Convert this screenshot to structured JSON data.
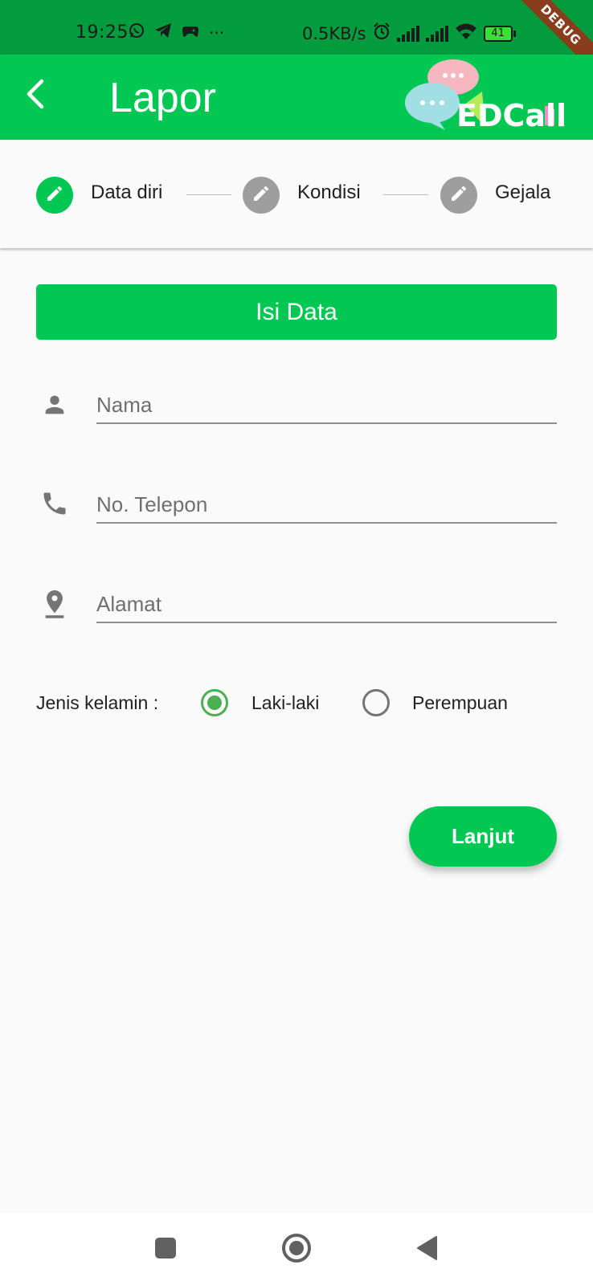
{
  "status_bar": {
    "time": "19:25",
    "extra_icons": "···",
    "net_speed": "0.5KB/s",
    "battery": "41",
    "debug_banner": "DEBUG"
  },
  "app_bar": {
    "title": "Lapor",
    "logo_text": "EDCall",
    "back_icon": "chevron-left-icon"
  },
  "stepper": {
    "steps": [
      {
        "label": "Data diri",
        "state": "active",
        "color": "#02c853"
      },
      {
        "label": "Kondisi",
        "state": "inactive",
        "color": "#9e9e9e"
      },
      {
        "label": "Gejala",
        "state": "inactive",
        "color": "#9e9e9e"
      }
    ]
  },
  "form": {
    "section_button": "Isi Data",
    "fields": [
      {
        "placeholder": "Nama",
        "value": "",
        "icon": "person-icon"
      },
      {
        "placeholder": "No. Telepon",
        "value": "",
        "icon": "phone-icon"
      },
      {
        "placeholder": "Alamat",
        "value": "",
        "icon": "location-pin-icon"
      }
    ],
    "gender": {
      "label": "Jenis kelamin :",
      "options": [
        {
          "label": "Laki-laki",
          "selected": true
        },
        {
          "label": "Perempuan",
          "selected": false
        }
      ]
    },
    "submit_label": "Lanjut"
  },
  "colors": {
    "primary": "#02c853",
    "status_bar": "#029b3d",
    "radio_selected": "#4caf50"
  }
}
